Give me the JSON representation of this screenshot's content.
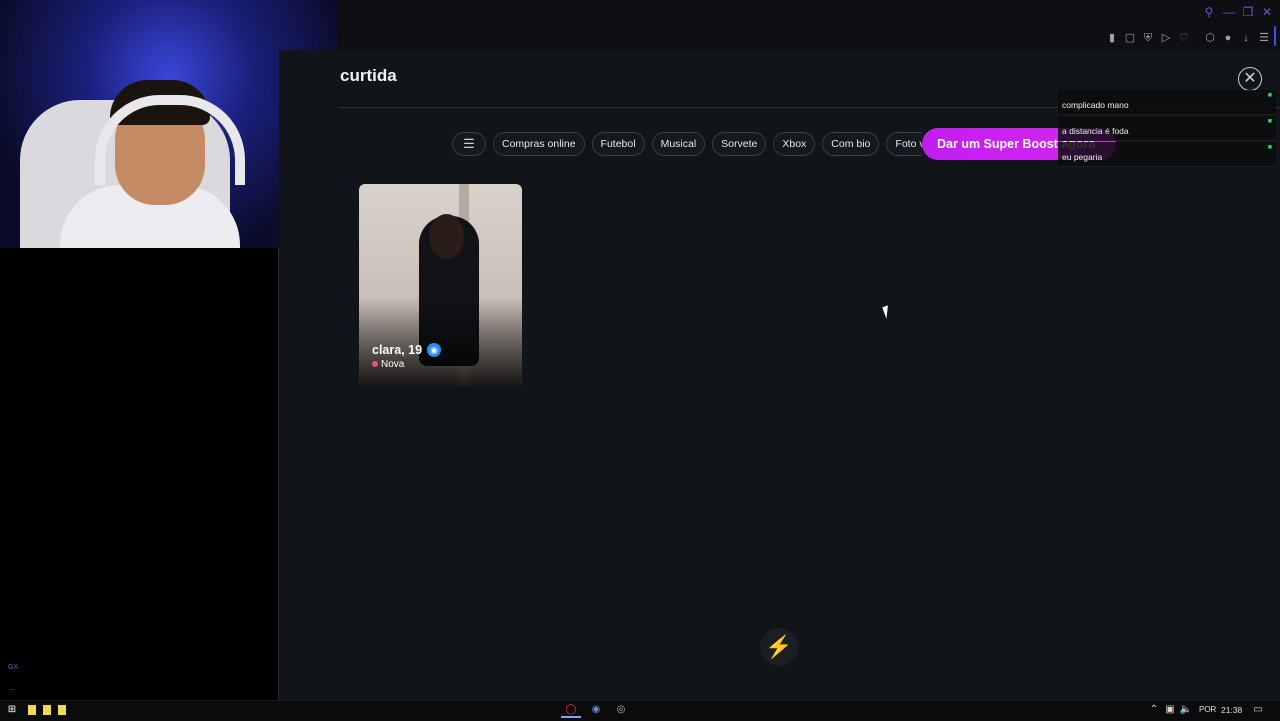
{
  "page": {
    "heading": "curtida"
  },
  "filters": {
    "settings_icon": "sliders-icon",
    "chips": [
      "Compras online",
      "Futebol",
      "Musical",
      "Sorvete",
      "Xbox",
      "Com bio",
      "Foto veri"
    ]
  },
  "boost": {
    "label": "Dar um Super Boost agora",
    "color": "#c21df0"
  },
  "card": {
    "name": "clara, 19",
    "status": "Nova",
    "verified_icon": "camera-verified-icon"
  },
  "chat": {
    "messages": [
      {
        "text": "complicado mano"
      },
      {
        "text": "a distancia é foda"
      },
      {
        "text": "eu pegaria"
      }
    ]
  },
  "taskbar": {
    "lang": "POR",
    "time": "21:38"
  },
  "overlay": {
    "gx": "GX",
    "dots": "..."
  }
}
